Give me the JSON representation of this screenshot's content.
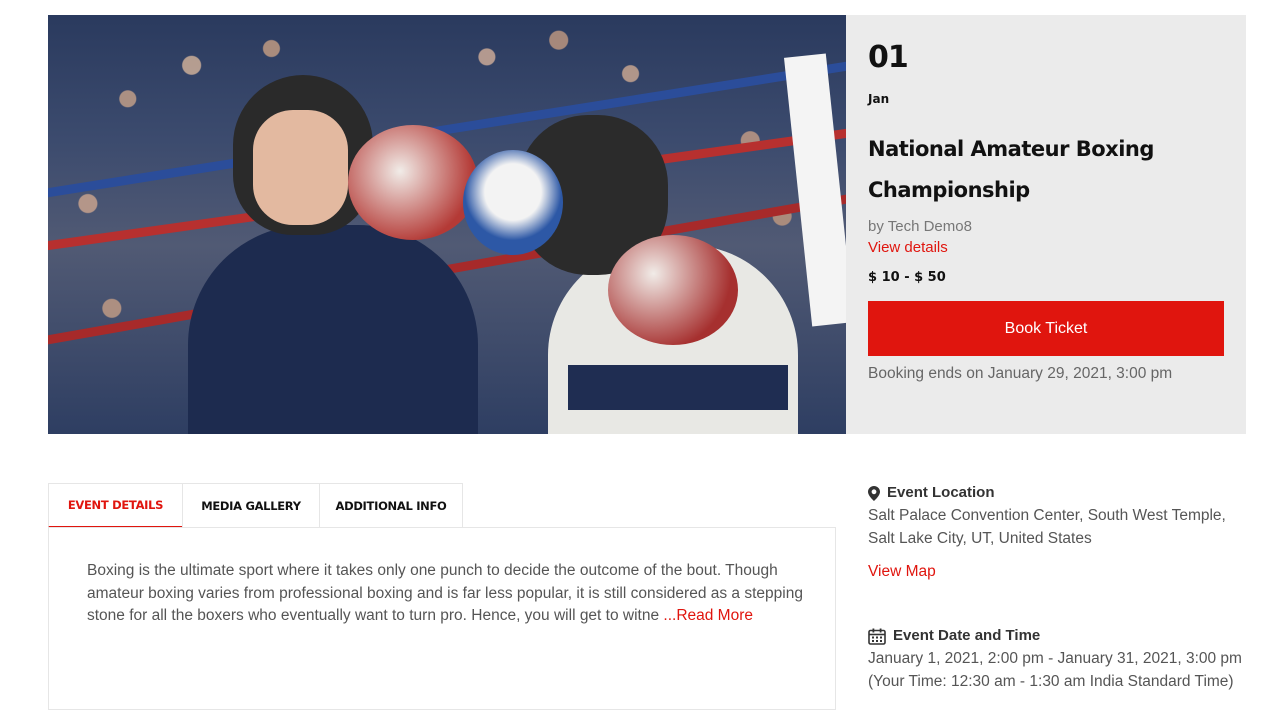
{
  "event": {
    "day": "01",
    "month": "Jan",
    "title": "National Amateur Boxing Championship",
    "byline": "by Tech Demo8",
    "view_details": "View details",
    "price": "$ 10 - $ 50",
    "book_label": "Book Ticket",
    "booking_ends": "Booking ends on January 29, 2021, 3:00 pm"
  },
  "tabs": [
    {
      "label": "EVENT DETAILS",
      "active": true
    },
    {
      "label": "MEDIA GALLERY",
      "active": false
    },
    {
      "label": "ADDITIONAL INFO",
      "active": false
    }
  ],
  "details": {
    "text": "Boxing is the ultimate sport where it takes only one punch to decide the outcome of the bout. Though amateur boxing varies from professional boxing and is far less popular, it is still considered as a stepping stone for all the boxers who eventually want to turn pro. Hence, you will get to witne ",
    "read_more": "...Read More"
  },
  "location": {
    "heading": "Event Location",
    "address": "Salt Palace Convention Center, South West Temple, Salt Lake City, UT, United States",
    "view_map": "View Map",
    "icon": "map-marker-icon"
  },
  "datetime": {
    "heading": "Event Date and Time",
    "text": "January 1, 2021, 2:00 pm - January 31, 2021, 3:00 pm (Your Time: 12:30 am - 1:30 am India Standard Time)",
    "icon": "calendar-icon"
  },
  "colors": {
    "accent": "#e0150e",
    "card_bg": "#ebebeb"
  }
}
